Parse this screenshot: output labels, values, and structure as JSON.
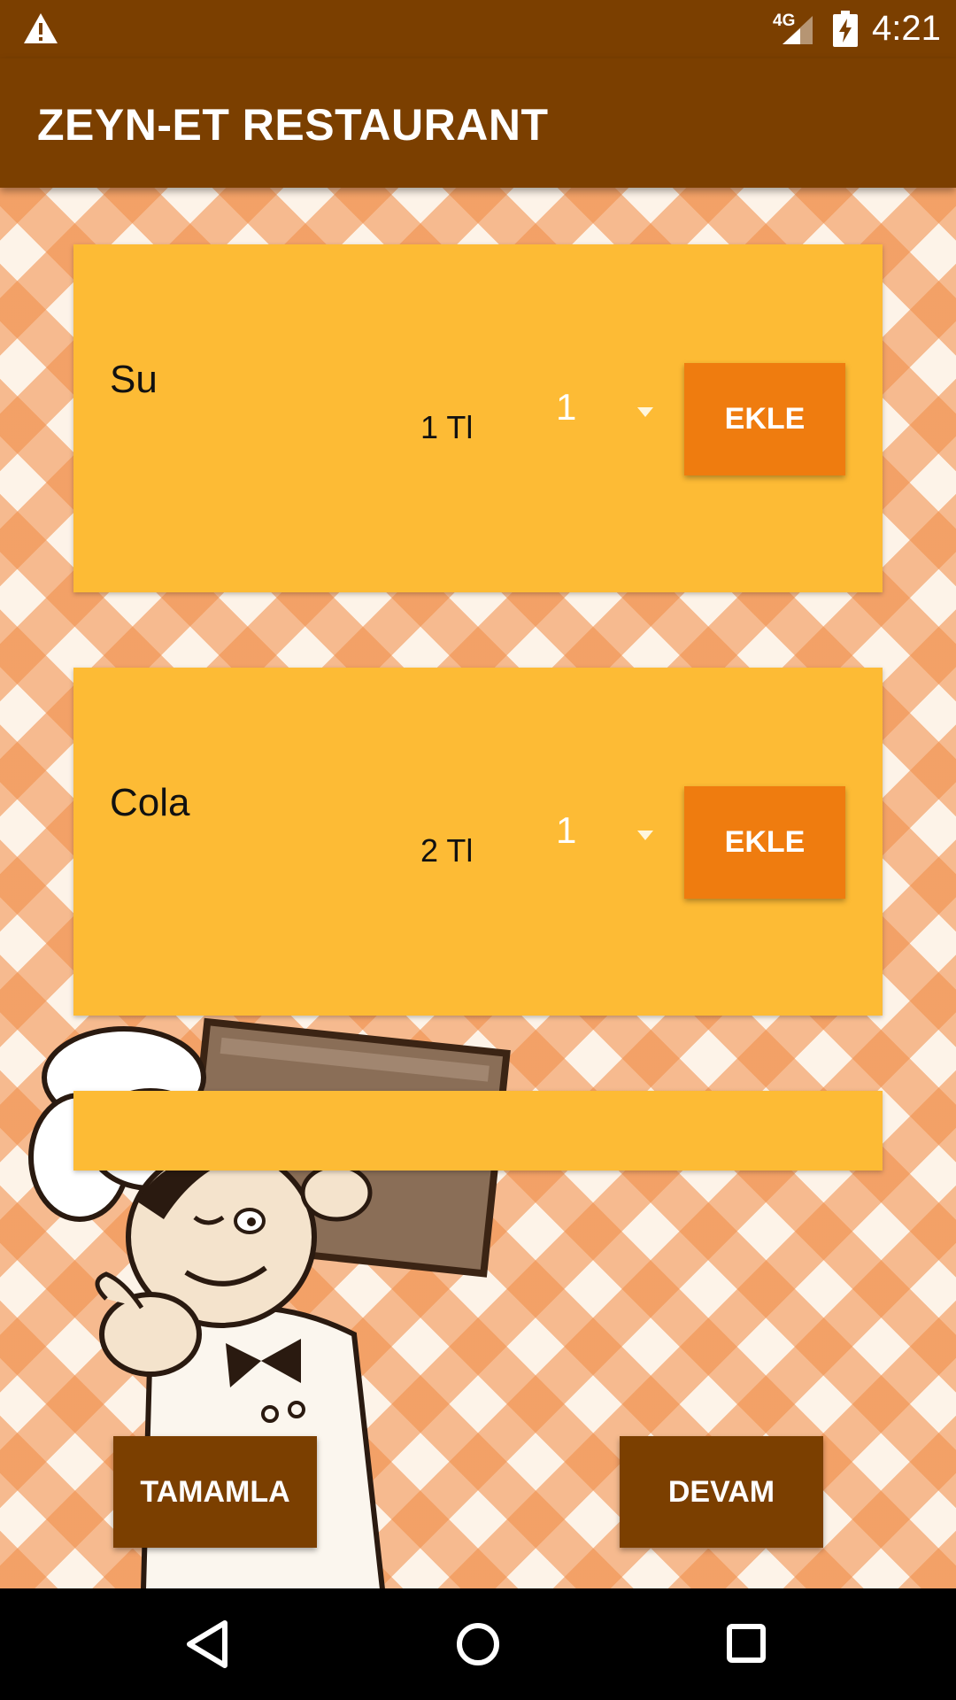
{
  "status_bar": {
    "warning_icon": "warning-icon",
    "network": "4G",
    "signal_icon": "cell-signal-icon",
    "battery_icon": "battery-charging-icon",
    "time": "4:21"
  },
  "app_bar": {
    "title": "ZEYN-ET RESTAURANT"
  },
  "items": [
    {
      "name": "Su",
      "price": "1 Tl",
      "quantity": "1",
      "add_label": "EKLE"
    },
    {
      "name": "Cola",
      "price": "2 Tl",
      "quantity": "1",
      "add_label": "EKLE"
    }
  ],
  "actions": {
    "complete_label": "TAMAMLA",
    "continue_label": "DEVAM"
  },
  "nav_bar": {
    "back_icon": "back-triangle-icon",
    "home_icon": "home-circle-icon",
    "recents_icon": "recents-square-icon"
  },
  "colors": {
    "brand_brown": "#7b3f00",
    "card_yellow": "#fdbb35",
    "button_orange": "#ef7c0f",
    "pattern_orange": "#f08c46"
  }
}
